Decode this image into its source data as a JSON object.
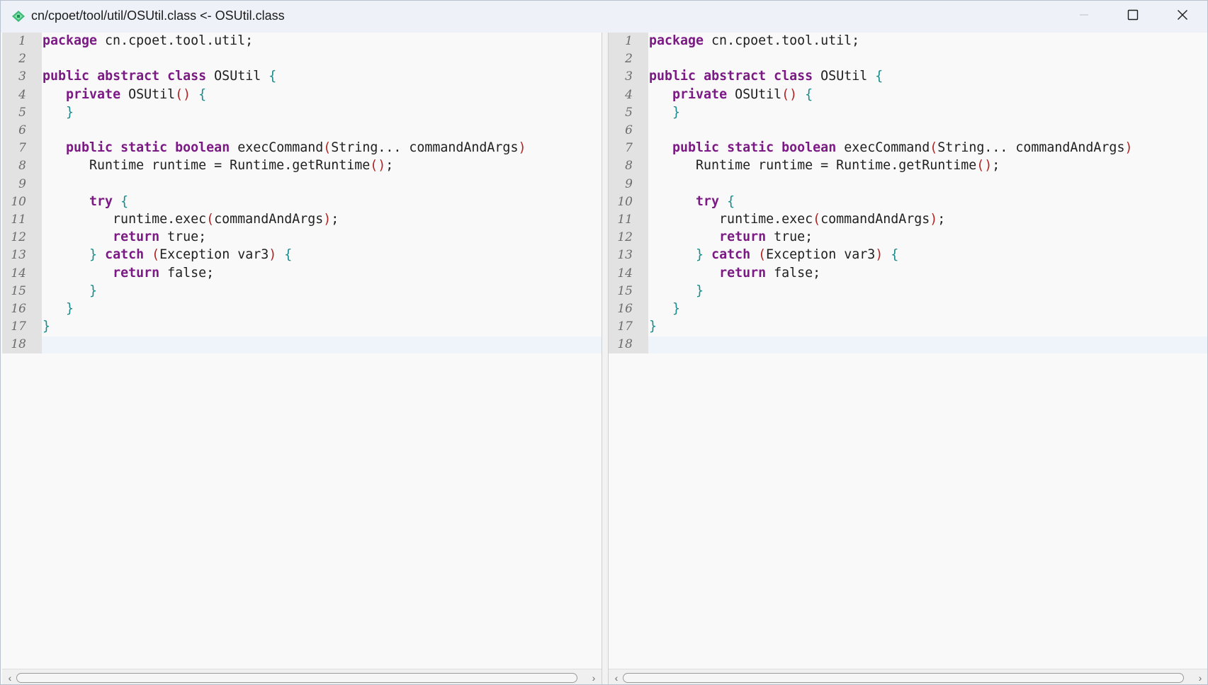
{
  "window": {
    "title": "cn/cpoet/tool/util/OSUtil.class <- OSUtil.class"
  },
  "icons": {
    "app": "java-class-icon",
    "minimize": "minimize-icon",
    "maximize": "maximize-icon",
    "close": "close-icon",
    "scroll_left": "chevron-left-icon",
    "scroll_right": "chevron-right-icon"
  },
  "colors": {
    "keyword": "#7b1a84",
    "brace": "#1a8a8a",
    "paren": "#b22222",
    "text": "#202020",
    "line_number": "#6c6c6c",
    "gutter": "#e2e2e2",
    "editor_bg": "#f9f9f9",
    "titlebar_bg": "#eef2f8"
  },
  "panes": [
    {
      "name": "left",
      "lines": [
        {
          "n": "1",
          "tokens": [
            {
              "t": "package",
              "c": "kw"
            },
            {
              "t": " cn.cpoet.tool.util;"
            }
          ]
        },
        {
          "n": "2",
          "tokens": []
        },
        {
          "n": "3",
          "tokens": [
            {
              "t": "public",
              "c": "kw"
            },
            {
              "t": " "
            },
            {
              "t": "abstract",
              "c": "kw"
            },
            {
              "t": " "
            },
            {
              "t": "class",
              "c": "kw"
            },
            {
              "t": " OSUtil "
            },
            {
              "t": "{",
              "c": "brace"
            }
          ]
        },
        {
          "n": "4",
          "tokens": [
            {
              "t": "   "
            },
            {
              "t": "private",
              "c": "kw"
            },
            {
              "t": " OSUtil"
            },
            {
              "t": "()",
              "c": "paren"
            },
            {
              "t": " "
            },
            {
              "t": "{",
              "c": "brace"
            }
          ]
        },
        {
          "n": "5",
          "tokens": [
            {
              "t": "   "
            },
            {
              "t": "}",
              "c": "brace"
            }
          ]
        },
        {
          "n": "6",
          "tokens": []
        },
        {
          "n": "7",
          "tokens": [
            {
              "t": "   "
            },
            {
              "t": "public",
              "c": "kw"
            },
            {
              "t": " "
            },
            {
              "t": "static",
              "c": "kw"
            },
            {
              "t": " "
            },
            {
              "t": "boolean",
              "c": "kw"
            },
            {
              "t": " execCommand"
            },
            {
              "t": "(",
              "c": "paren"
            },
            {
              "t": "String... commandAndArgs"
            },
            {
              "t": ")",
              "c": "paren"
            }
          ]
        },
        {
          "n": "8",
          "tokens": [
            {
              "t": "      Runtime runtime = Runtime.getRuntime"
            },
            {
              "t": "()",
              "c": "paren"
            },
            {
              "t": ";"
            }
          ]
        },
        {
          "n": "9",
          "tokens": []
        },
        {
          "n": "10",
          "tokens": [
            {
              "t": "      "
            },
            {
              "t": "try",
              "c": "kw"
            },
            {
              "t": " "
            },
            {
              "t": "{",
              "c": "brace"
            }
          ]
        },
        {
          "n": "11",
          "tokens": [
            {
              "t": "         runtime.exec"
            },
            {
              "t": "(",
              "c": "paren"
            },
            {
              "t": "commandAndArgs"
            },
            {
              "t": ")",
              "c": "paren"
            },
            {
              "t": ";"
            }
          ]
        },
        {
          "n": "12",
          "tokens": [
            {
              "t": "         "
            },
            {
              "t": "return",
              "c": "kw"
            },
            {
              "t": " true;"
            }
          ]
        },
        {
          "n": "13",
          "tokens": [
            {
              "t": "      "
            },
            {
              "t": "}",
              "c": "brace"
            },
            {
              "t": " "
            },
            {
              "t": "catch",
              "c": "kw"
            },
            {
              "t": " "
            },
            {
              "t": "(",
              "c": "paren"
            },
            {
              "t": "Exception var3"
            },
            {
              "t": ")",
              "c": "paren"
            },
            {
              "t": " "
            },
            {
              "t": "{",
              "c": "brace"
            }
          ]
        },
        {
          "n": "14",
          "tokens": [
            {
              "t": "         "
            },
            {
              "t": "return",
              "c": "kw"
            },
            {
              "t": " false;"
            }
          ]
        },
        {
          "n": "15",
          "tokens": [
            {
              "t": "      "
            },
            {
              "t": "}",
              "c": "brace"
            }
          ]
        },
        {
          "n": "16",
          "tokens": [
            {
              "t": "   "
            },
            {
              "t": "}",
              "c": "brace"
            }
          ]
        },
        {
          "n": "17",
          "tokens": [
            {
              "t": "}",
              "c": "brace"
            }
          ]
        },
        {
          "n": "18",
          "tokens": []
        }
      ]
    },
    {
      "name": "right",
      "lines": [
        {
          "n": "1",
          "tokens": [
            {
              "t": "package",
              "c": "kw"
            },
            {
              "t": " cn.cpoet.tool.util;"
            }
          ]
        },
        {
          "n": "2",
          "tokens": []
        },
        {
          "n": "3",
          "tokens": [
            {
              "t": "public",
              "c": "kw"
            },
            {
              "t": " "
            },
            {
              "t": "abstract",
              "c": "kw"
            },
            {
              "t": " "
            },
            {
              "t": "class",
              "c": "kw"
            },
            {
              "t": " OSUtil "
            },
            {
              "t": "{",
              "c": "brace"
            }
          ]
        },
        {
          "n": "4",
          "tokens": [
            {
              "t": "   "
            },
            {
              "t": "private",
              "c": "kw"
            },
            {
              "t": " OSUtil"
            },
            {
              "t": "()",
              "c": "paren"
            },
            {
              "t": " "
            },
            {
              "t": "{",
              "c": "brace"
            }
          ]
        },
        {
          "n": "5",
          "tokens": [
            {
              "t": "   "
            },
            {
              "t": "}",
              "c": "brace"
            }
          ]
        },
        {
          "n": "6",
          "tokens": []
        },
        {
          "n": "7",
          "tokens": [
            {
              "t": "   "
            },
            {
              "t": "public",
              "c": "kw"
            },
            {
              "t": " "
            },
            {
              "t": "static",
              "c": "kw"
            },
            {
              "t": " "
            },
            {
              "t": "boolean",
              "c": "kw"
            },
            {
              "t": " execCommand"
            },
            {
              "t": "(",
              "c": "paren"
            },
            {
              "t": "String... commandAndArgs"
            },
            {
              "t": ")",
              "c": "paren"
            }
          ]
        },
        {
          "n": "8",
          "tokens": [
            {
              "t": "      Runtime runtime = Runtime.getRuntime"
            },
            {
              "t": "()",
              "c": "paren"
            },
            {
              "t": ";"
            }
          ]
        },
        {
          "n": "9",
          "tokens": []
        },
        {
          "n": "10",
          "tokens": [
            {
              "t": "      "
            },
            {
              "t": "try",
              "c": "kw"
            },
            {
              "t": " "
            },
            {
              "t": "{",
              "c": "brace"
            }
          ]
        },
        {
          "n": "11",
          "tokens": [
            {
              "t": "         runtime.exec"
            },
            {
              "t": "(",
              "c": "paren"
            },
            {
              "t": "commandAndArgs"
            },
            {
              "t": ")",
              "c": "paren"
            },
            {
              "t": ";"
            }
          ]
        },
        {
          "n": "12",
          "tokens": [
            {
              "t": "         "
            },
            {
              "t": "return",
              "c": "kw"
            },
            {
              "t": " true;"
            }
          ]
        },
        {
          "n": "13",
          "tokens": [
            {
              "t": "      "
            },
            {
              "t": "}",
              "c": "brace"
            },
            {
              "t": " "
            },
            {
              "t": "catch",
              "c": "kw"
            },
            {
              "t": " "
            },
            {
              "t": "(",
              "c": "paren"
            },
            {
              "t": "Exception var3"
            },
            {
              "t": ")",
              "c": "paren"
            },
            {
              "t": " "
            },
            {
              "t": "{",
              "c": "brace"
            }
          ]
        },
        {
          "n": "14",
          "tokens": [
            {
              "t": "         "
            },
            {
              "t": "return",
              "c": "kw"
            },
            {
              "t": " false;"
            }
          ]
        },
        {
          "n": "15",
          "tokens": [
            {
              "t": "      "
            },
            {
              "t": "}",
              "c": "brace"
            }
          ]
        },
        {
          "n": "16",
          "tokens": [
            {
              "t": "   "
            },
            {
              "t": "}",
              "c": "brace"
            }
          ]
        },
        {
          "n": "17",
          "tokens": [
            {
              "t": "}",
              "c": "brace"
            }
          ]
        },
        {
          "n": "18",
          "tokens": []
        }
      ]
    }
  ]
}
